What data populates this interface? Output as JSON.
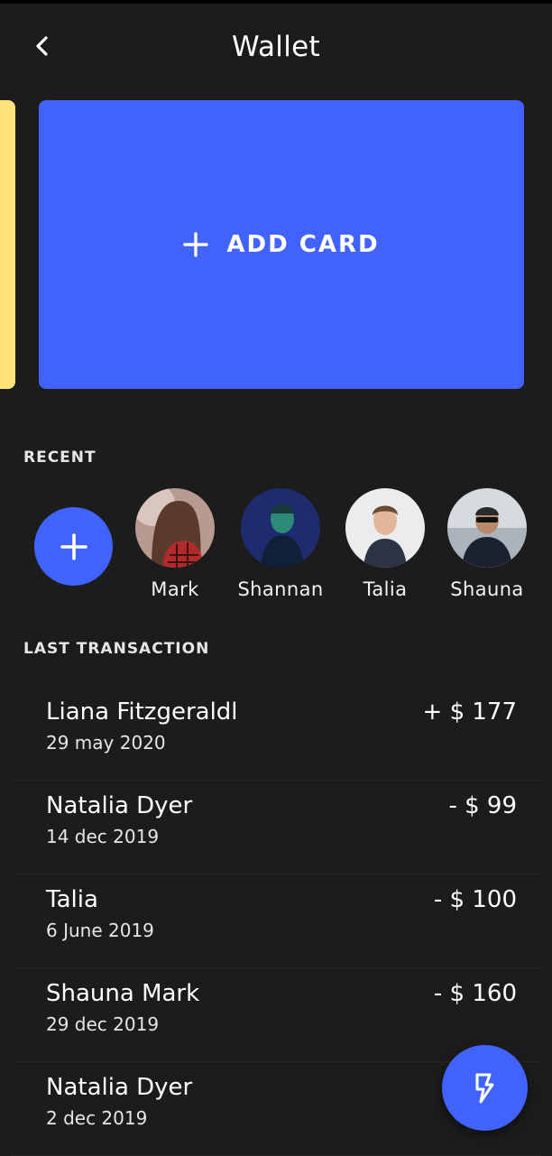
{
  "header": {
    "title": "Wallet",
    "back_icon": "chevron-left-icon"
  },
  "cards": {
    "add_card_label": "ADD CARD",
    "add_card_icon": "plus-icon",
    "add_card_color": "#4263fb",
    "peek_card_color": "#ffe27a"
  },
  "recent": {
    "title": "RECENT",
    "add_icon": "plus-icon",
    "contacts": [
      {
        "name": "Mark"
      },
      {
        "name": "Shannan"
      },
      {
        "name": "Talia"
      },
      {
        "name": "Shauna"
      }
    ]
  },
  "transactions": {
    "title": "LAST TRANSACTION",
    "items": [
      {
        "name": "Liana Fitzgeraldl",
        "date": "29 may 2020",
        "amount": "+ $ 177"
      },
      {
        "name": "Natalia Dyer",
        "date": "14 dec 2019",
        "amount": "- $ 99"
      },
      {
        "name": "Talia",
        "date": "6 June 2019",
        "amount": "- $ 100"
      },
      {
        "name": "Shauna Mark",
        "date": "29 dec 2019",
        "amount": "- $ 160"
      },
      {
        "name": "Natalia Dyer",
        "date": "2 dec 2019",
        "amount": ""
      }
    ]
  },
  "fab": {
    "icon": "lightning-icon"
  },
  "colors": {
    "background": "#1c1c1c",
    "accent": "#4263fb",
    "text": "#ffffff"
  }
}
